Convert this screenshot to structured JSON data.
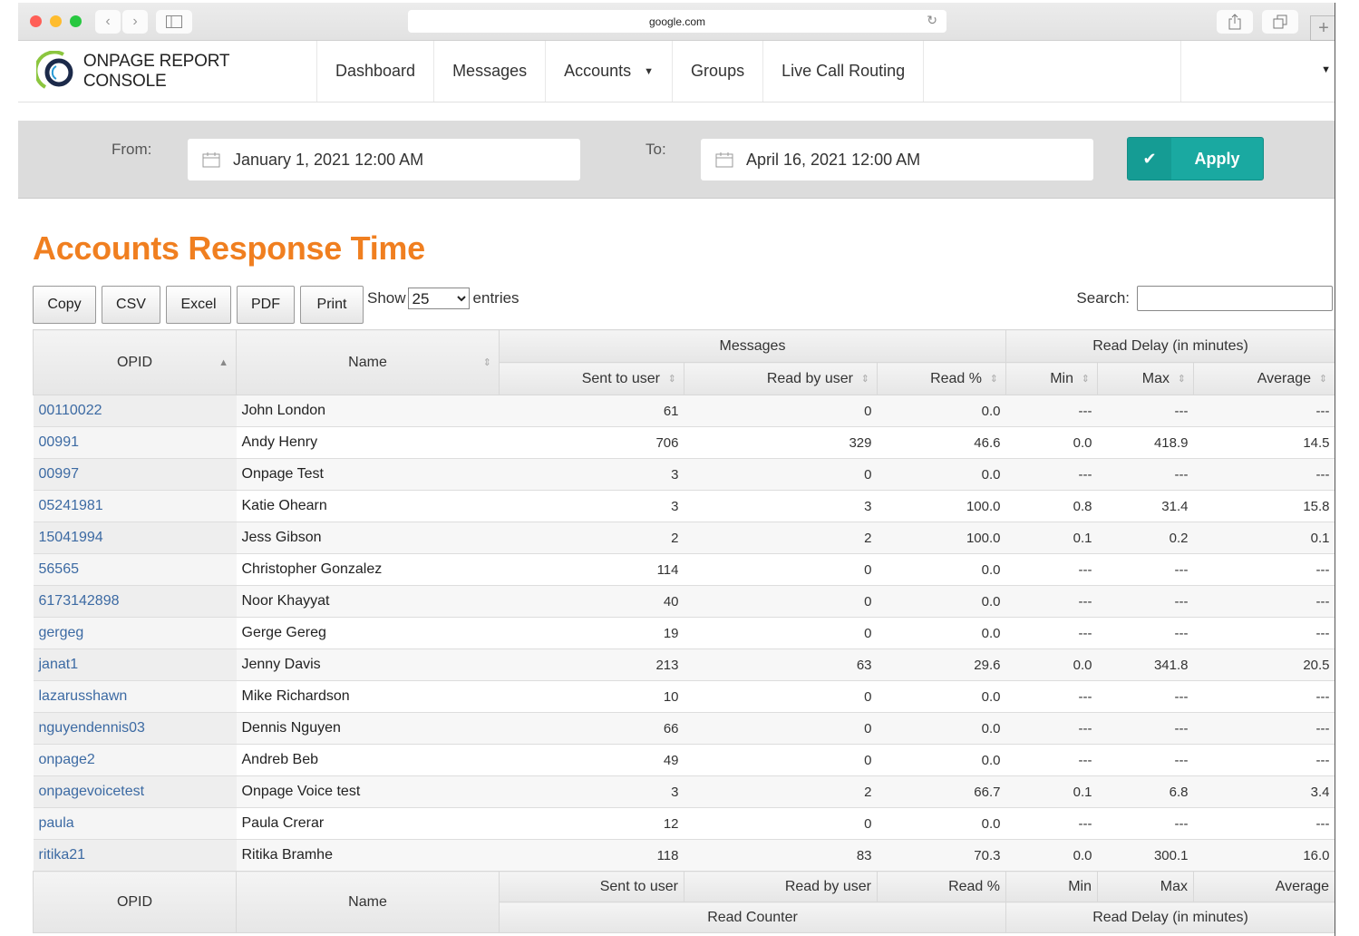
{
  "browser": {
    "url": "google.com"
  },
  "nav": {
    "brand": "ONPAGE REPORT CONSOLE",
    "items": [
      {
        "label": "Dashboard"
      },
      {
        "label": "Messages"
      },
      {
        "label": "Accounts",
        "has_dropdown": true
      },
      {
        "label": "Groups"
      },
      {
        "label": "Live Call Routing"
      }
    ]
  },
  "filter": {
    "from_label": "From:",
    "from_value": "January 1, 2021 12:00 AM",
    "to_label": "To:",
    "to_value": "April 16, 2021 12:00 AM",
    "apply_label": "Apply",
    "apply_color": "#1aa9a1"
  },
  "page": {
    "title": "Accounts Response Time",
    "title_color": "#f07f20"
  },
  "toolbar": {
    "buttons": [
      "Copy",
      "CSV",
      "Excel",
      "PDF",
      "Print"
    ],
    "show_label": "Show",
    "entries_label": "entries",
    "page_size": "25",
    "search_label": "Search:",
    "search_value": ""
  },
  "table": {
    "group_headers": {
      "messages": "Messages",
      "read_delay": "Read Delay (in minutes)"
    },
    "columns": {
      "opid": "OPID",
      "name": "Name",
      "sent": "Sent to user",
      "read": "Read by user",
      "read_pct": "Read %",
      "min": "Min",
      "max": "Max",
      "avg": "Average"
    },
    "footer_groups": {
      "read_counter": "Read Counter",
      "read_delay": "Read Delay (in minutes)"
    },
    "rows": [
      {
        "opid": "00110022",
        "name": "John London",
        "sent": "61",
        "read": "0",
        "read_pct": "0.0",
        "min": "---",
        "max": "---",
        "avg": "---"
      },
      {
        "opid": "00991",
        "name": "Andy Henry",
        "sent": "706",
        "read": "329",
        "read_pct": "46.6",
        "min": "0.0",
        "max": "418.9",
        "avg": "14.5"
      },
      {
        "opid": "00997",
        "name": "Onpage Test",
        "sent": "3",
        "read": "0",
        "read_pct": "0.0",
        "min": "---",
        "max": "---",
        "avg": "---"
      },
      {
        "opid": "05241981",
        "name": "Katie Ohearn",
        "sent": "3",
        "read": "3",
        "read_pct": "100.0",
        "min": "0.8",
        "max": "31.4",
        "avg": "15.8"
      },
      {
        "opid": "15041994",
        "name": "Jess Gibson",
        "sent": "2",
        "read": "2",
        "read_pct": "100.0",
        "min": "0.1",
        "max": "0.2",
        "avg": "0.1"
      },
      {
        "opid": "56565",
        "name": "Christopher Gonzalez",
        "sent": "114",
        "read": "0",
        "read_pct": "0.0",
        "min": "---",
        "max": "---",
        "avg": "---"
      },
      {
        "opid": "6173142898",
        "name": "Noor Khayyat",
        "sent": "40",
        "read": "0",
        "read_pct": "0.0",
        "min": "---",
        "max": "---",
        "avg": "---"
      },
      {
        "opid": "gergeg",
        "name": "Gerge Gereg",
        "sent": "19",
        "read": "0",
        "read_pct": "0.0",
        "min": "---",
        "max": "---",
        "avg": "---"
      },
      {
        "opid": "janat1",
        "name": "Jenny Davis",
        "sent": "213",
        "read": "63",
        "read_pct": "29.6",
        "min": "0.0",
        "max": "341.8",
        "avg": "20.5"
      },
      {
        "opid": "lazarusshawn",
        "name": "Mike Richardson",
        "sent": "10",
        "read": "0",
        "read_pct": "0.0",
        "min": "---",
        "max": "---",
        "avg": "---"
      },
      {
        "opid": "nguyendennis03",
        "name": "Dennis Nguyen",
        "sent": "66",
        "read": "0",
        "read_pct": "0.0",
        "min": "---",
        "max": "---",
        "avg": "---"
      },
      {
        "opid": "onpage2",
        "name": "Andreb Beb",
        "sent": "49",
        "read": "0",
        "read_pct": "0.0",
        "min": "---",
        "max": "---",
        "avg": "---"
      },
      {
        "opid": "onpagevoicetest",
        "name": "Onpage Voice test",
        "sent": "3",
        "read": "2",
        "read_pct": "66.7",
        "min": "0.1",
        "max": "6.8",
        "avg": "3.4"
      },
      {
        "opid": "paula",
        "name": "Paula Crerar",
        "sent": "12",
        "read": "0",
        "read_pct": "0.0",
        "min": "---",
        "max": "---",
        "avg": "---"
      },
      {
        "opid": "ritika21",
        "name": "Ritika Bramhe",
        "sent": "118",
        "read": "83",
        "read_pct": "70.3",
        "min": "0.0",
        "max": "300.1",
        "avg": "16.0"
      }
    ]
  }
}
